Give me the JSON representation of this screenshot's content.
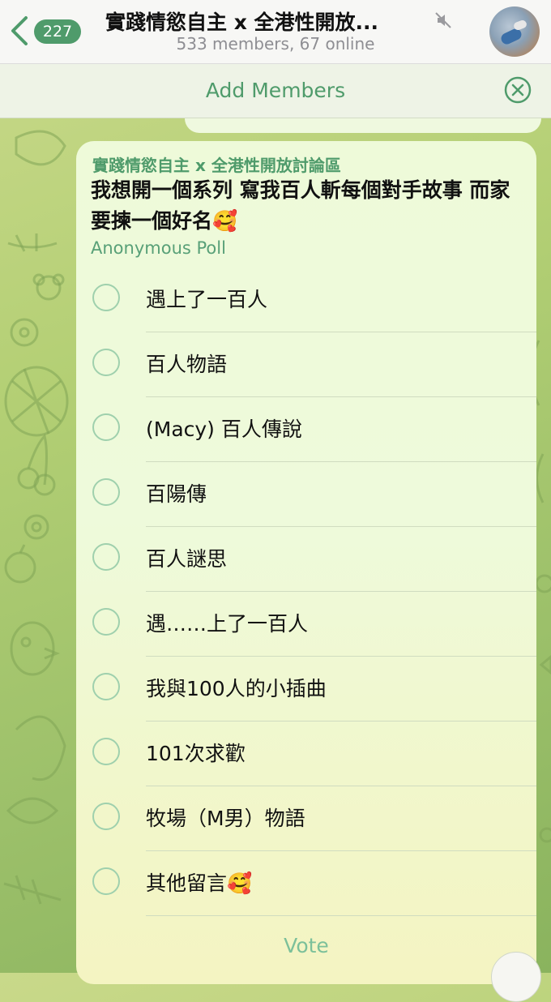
{
  "header": {
    "back_count": "227",
    "title": "實踐情慾自主 x 全港性開放...",
    "subtitle": "533 members, 67 online"
  },
  "add_bar": {
    "label": "Add Members"
  },
  "poll": {
    "sender": "實踐情慾自主 x 全港性開放討論區",
    "question": "我想開一個系列 寫我百人斬每個對手故事 而家要揀一個好名🥰",
    "type": "Anonymous Poll",
    "options": [
      "遇上了一百人",
      "百人物語",
      "(Macy) 百人傳說",
      "百陽傳",
      "百人謎思",
      "遇……上了一百人",
      "我與100人的小插曲",
      "101次求歡",
      "牧場（M男）物語",
      "其他留言🥰"
    ],
    "vote_label": "Vote"
  },
  "colors": {
    "accent": "#4f9b6b",
    "bubble": "#eefad9",
    "radio": "#9fd0ad",
    "wallpaper": "#a9c86e"
  },
  "icons": [
    "back-chevron-icon",
    "mute-icon",
    "close-circle-icon",
    "radio-circle-icon"
  ]
}
